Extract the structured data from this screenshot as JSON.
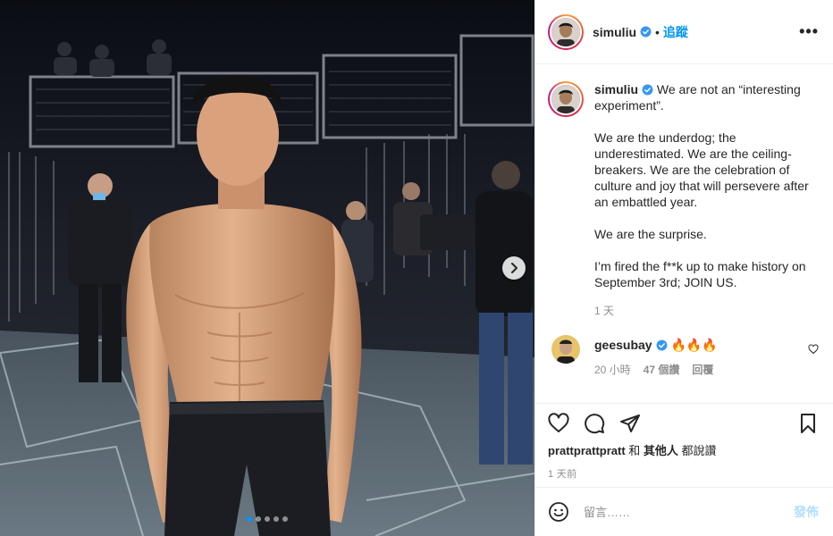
{
  "post": {
    "author": "simuliu",
    "follow_label": "追蹤",
    "separator": "•",
    "more_label": "•••"
  },
  "caption": {
    "username": "simuliu",
    "paragraphs": [
      "We are not an “interesting experiment”.",
      "We are the underdog; the underestimated. We are the ceiling-breakers. We are the celebration of culture and joy that will persevere after an embattled year.",
      "We are the surprise.",
      "I’m fired the f**k up to make history on September 3rd; JOIN US."
    ],
    "time": "1 天"
  },
  "comments": [
    {
      "username": "geesubay",
      "text": "🔥🔥🔥",
      "time": "20 小時",
      "likes": "47 個讚",
      "reply_label": "回覆"
    }
  ],
  "likes": {
    "first_user": "prattprattpratt",
    "connector": " 和 ",
    "others": "其他人",
    "suffix": " 都說讚"
  },
  "posted_ago": "1 天前",
  "comment_input": {
    "placeholder": "留言……",
    "post_label": "發佈"
  },
  "carousel": {
    "total": 5,
    "active_index": 0
  },
  "icons": {
    "verified": "verified-badge-icon",
    "like": "heart-icon",
    "comment": "speech-bubble-icon",
    "share": "paper-plane-icon",
    "save": "bookmark-icon",
    "emoji": "smiley-icon",
    "next": "chevron-right-icon"
  },
  "colors": {
    "accent_blue": "#0095f6",
    "verified_blue": "#3897f0",
    "text_primary": "#262626",
    "text_secondary": "#8e8e8e",
    "post_disabled": "#b2dffc"
  }
}
